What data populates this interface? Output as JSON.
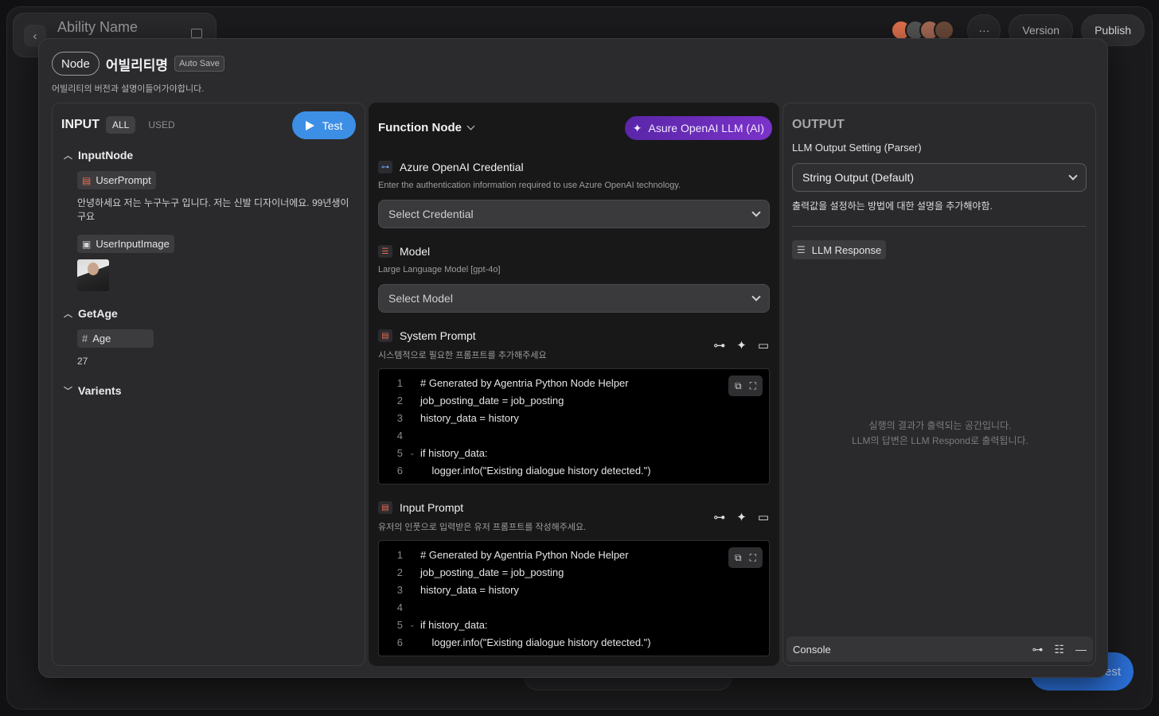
{
  "background": {
    "ability_title": "Ability Name",
    "version_label": "Version",
    "publish_label": "Publish",
    "more_label": "···",
    "test_label": "Test"
  },
  "modal": {
    "node_chip": "Node",
    "title": "어빌리티명",
    "autosave": "Auto Save",
    "description": "어빌리티의 버전과 설명이들어가야합니다."
  },
  "input_panel": {
    "title": "INPUT",
    "tabs": [
      "ALL",
      "USED"
    ],
    "test_label": "Test",
    "groups": [
      {
        "name": "InputNode",
        "vars": [
          {
            "name": "UserPrompt",
            "icon": "message-icon",
            "value": "안녕하세요 저는 누구누구 입니다. 저는 신발 디자이너에요. 99년생이구요"
          },
          {
            "name": "UserInputImage",
            "icon": "image-icon"
          }
        ]
      },
      {
        "name": "GetAge",
        "vars": [
          {
            "name": "Age",
            "icon": "hash-icon",
            "value": "27"
          }
        ]
      },
      {
        "name": "Varients"
      }
    ]
  },
  "function_panel": {
    "title": "Function Node",
    "ai_label": "Asure OpenAI LLM (AI)",
    "credential": {
      "title": "Azure OpenAI Credential",
      "description": "Enter the authentication information required to use Azure OpenAI technology.",
      "placeholder": "Select Credential"
    },
    "model": {
      "title": "Model",
      "description": "Large Language Model [gpt-4o]",
      "placeholder": "Select Model"
    },
    "system_prompt": {
      "title": "System Prompt",
      "description": "시스템적으로 필요한 프롬프트를 추가해주세요",
      "lines": [
        "# Generated by Agentria Python Node Helper",
        "job_posting_date = job_posting",
        "history_data = history",
        "",
        "if history_data:",
        "    logger.info(\"Existing dialogue history detected.\")"
      ]
    },
    "input_prompt": {
      "title": "Input Prompt",
      "description": "유저의 인풋으로 입력받은 유저 프롬프트를 작성해주세요.",
      "lines": [
        "# Generated by Agentria Python Node Helper",
        "job_posting_date = job_posting",
        "history_data = history",
        "",
        "if history_data:",
        "    logger.info(\"Existing dialogue history detected.\")"
      ]
    }
  },
  "output_panel": {
    "title": "OUTPUT",
    "setting_label": "LLM Output Setting (Parser)",
    "parser_value": "String Output (Default)",
    "description": "출력값을 설정하는 방법에 대한 설명을 추가해야함.",
    "response_chip": "LLM Response",
    "placeholder_line1": "실행의 결과가 출력되는 공간입니다.",
    "placeholder_line2": "LLM의 답변은 LLM Respond로 출력됩니다.",
    "console_label": "Console"
  }
}
